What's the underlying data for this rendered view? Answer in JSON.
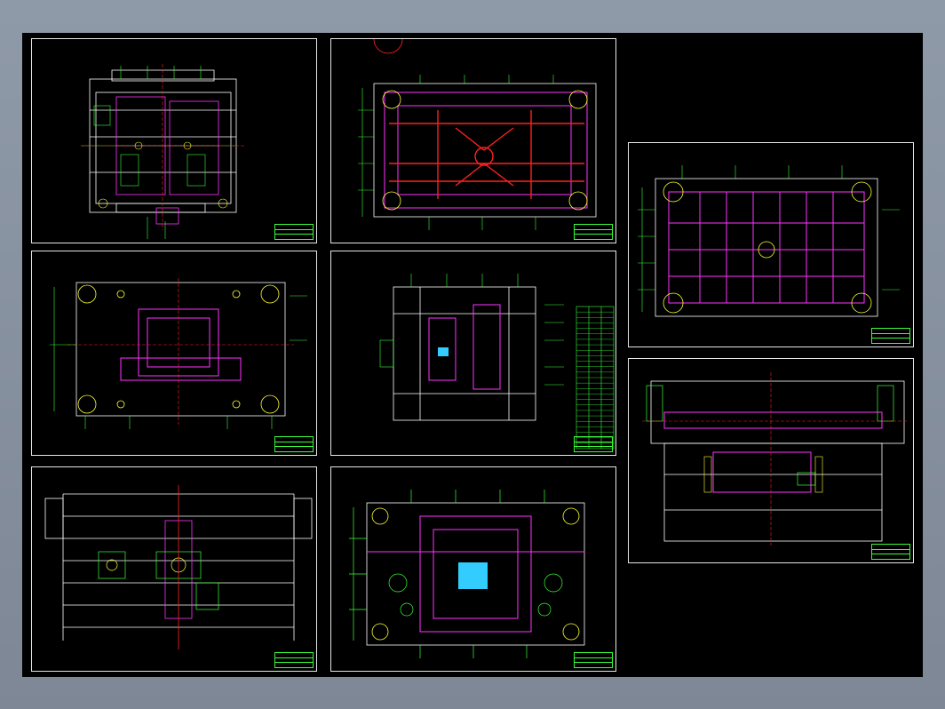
{
  "viewer": {
    "background": "#000000",
    "frame_color": "#e6e6e6"
  },
  "colors": {
    "outline": "#ffffff",
    "dimension": "#39ff39",
    "plate": "#ff33ff",
    "centerline": "#ff2020",
    "annotation": "#ffff33",
    "highlight": "#33ccff"
  },
  "sheets": [
    {
      "id": "sheet-1",
      "view": "front-section"
    },
    {
      "id": "sheet-2",
      "view": "plate-top-red"
    },
    {
      "id": "sheet-3",
      "view": "plate-top-large"
    },
    {
      "id": "sheet-4",
      "view": "plate-top-center"
    },
    {
      "id": "sheet-5",
      "view": "side-section"
    },
    {
      "id": "sheet-6",
      "view": "long-section"
    },
    {
      "id": "sheet-7",
      "view": "plate-lines"
    },
    {
      "id": "sheet-8",
      "view": "plate-top-cyan"
    }
  ],
  "bom_table": {
    "rows": 26
  }
}
